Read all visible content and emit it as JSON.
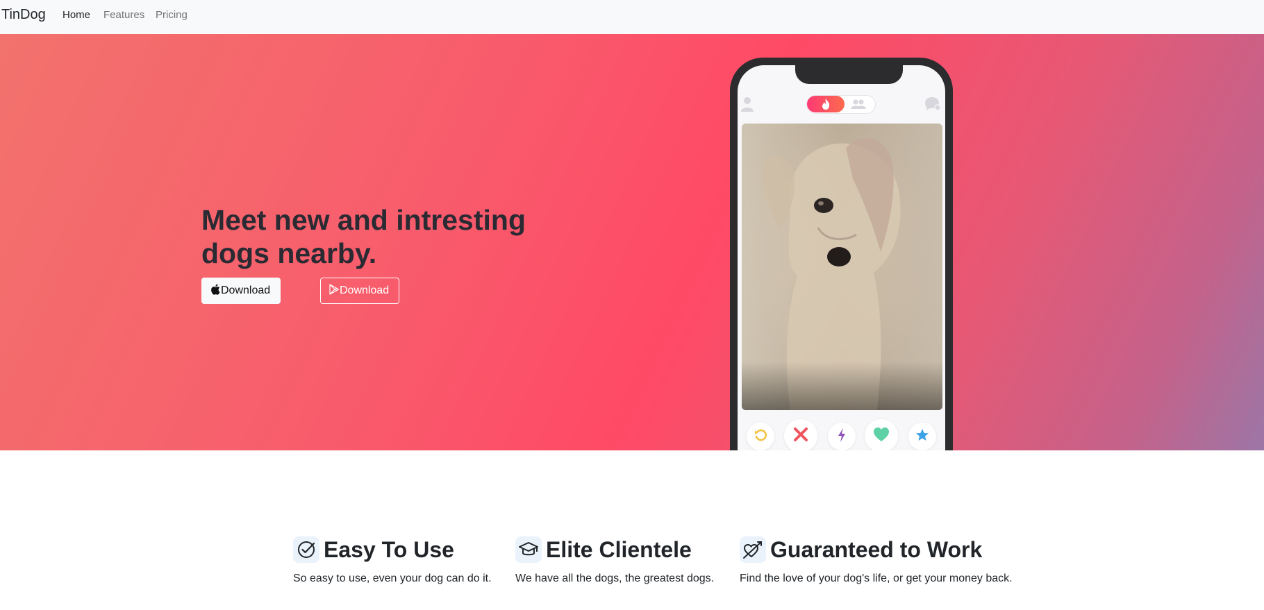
{
  "navbar": {
    "brand": "TinDog",
    "links": [
      {
        "label": "Home",
        "active": true
      },
      {
        "label": "Features",
        "active": false
      },
      {
        "label": "Pricing",
        "active": false
      }
    ]
  },
  "hero": {
    "title": "Meet new and intresting dogs nearby.",
    "buttons": [
      {
        "label": "Download",
        "icon": "apple-icon",
        "style": "light"
      },
      {
        "label": "Download",
        "icon": "google-play-icon",
        "style": "outline-light"
      }
    ],
    "gradient_colors": [
      "#f2726d",
      "#ff4a66",
      "#9c76a6"
    ]
  },
  "phone": {
    "top_icons": [
      "profile-icon",
      "flame-icon",
      "group-icon",
      "chat-icon"
    ],
    "photo": "dog-photo",
    "action_buttons": [
      "rewind-icon",
      "nope-icon",
      "boost-icon",
      "like-icon",
      "super-like-icon"
    ]
  },
  "features": [
    {
      "title": "Easy To Use",
      "text": "So easy to use, even your dog can do it.",
      "icon": "check-circle-icon"
    },
    {
      "title": "Elite Clientele",
      "text": "We have all the dogs, the greatest dogs.",
      "icon": "graduation-cap-icon"
    },
    {
      "title": "Guaranteed to Work",
      "text": "Find the love of your dog's life, or get your money back.",
      "icon": "heart-arrow-icon"
    }
  ],
  "colors": {
    "navbar_bg": "#f8f9fa",
    "text_dark": "#212529",
    "feature_icon_bg": "#eaf2fb"
  }
}
